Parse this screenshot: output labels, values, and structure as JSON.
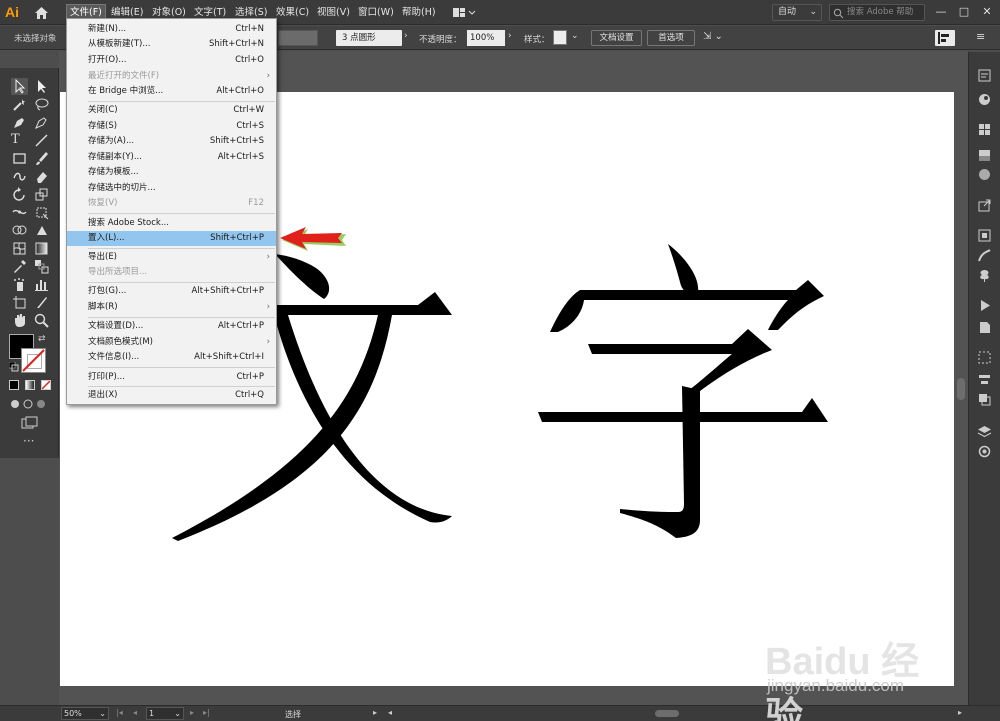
{
  "app": {
    "logo": "Ai"
  },
  "menubar": {
    "items": [
      "文件(F)",
      "编辑(E)",
      "对象(O)",
      "文字(T)",
      "选择(S)",
      "效果(C)",
      "视图(V)",
      "窗口(W)",
      "帮助(H)"
    ],
    "workspace": "自动",
    "search_placeholder": "搜索 Adobe 帮助",
    "window_buttons": [
      "—",
      "□",
      "✕"
    ]
  },
  "controlbar": {
    "no_selection": "未选择对象",
    "brush": "3 点圆形",
    "opacity_label": "不透明度：",
    "opacity_value": "100%",
    "style_label": "样式：",
    "doc_setup": "文档设置",
    "preferences": "首选项"
  },
  "file_menu": {
    "items": [
      {
        "label": "新建(N)...",
        "shortcut": "Ctrl+N"
      },
      {
        "label": "从模板新建(T)...",
        "shortcut": "Shift+Ctrl+N"
      },
      {
        "label": "打开(O)...",
        "shortcut": "Ctrl+O"
      },
      {
        "label": "最近打开的文件(F)",
        "shortcut": "›"
      },
      {
        "label": "在 Bridge 中浏览...",
        "shortcut": "Alt+Ctrl+O"
      },
      {
        "label": "关闭(C)",
        "shortcut": "Ctrl+W"
      },
      {
        "label": "存储(S)",
        "shortcut": "Ctrl+S"
      },
      {
        "label": "存储为(A)...",
        "shortcut": "Shift+Ctrl+S"
      },
      {
        "label": "存储副本(Y)...",
        "shortcut": "Alt+Ctrl+S"
      },
      {
        "label": "存储为模板...",
        "shortcut": ""
      },
      {
        "label": "存储选中的切片...",
        "shortcut": ""
      },
      {
        "label": "恢复(V)",
        "shortcut": "F12"
      },
      {
        "label": "搜索 Adobe Stock...",
        "shortcut": ""
      },
      {
        "label": "置入(L)...",
        "shortcut": "Shift+Ctrl+P"
      },
      {
        "label": "导出(E)",
        "shortcut": "›"
      },
      {
        "label": "导出所选项目...",
        "shortcut": ""
      },
      {
        "label": "打包(G)...",
        "shortcut": "Alt+Shift+Ctrl+P"
      },
      {
        "label": "脚本(R)",
        "shortcut": "›"
      },
      {
        "label": "文档设置(D)...",
        "shortcut": "Alt+Ctrl+P"
      },
      {
        "label": "文档颜色模式(M)",
        "shortcut": "›"
      },
      {
        "label": "文件信息(I)...",
        "shortcut": "Alt+Shift+Ctrl+I"
      },
      {
        "label": "打印(P)...",
        "shortcut": "Ctrl+P"
      },
      {
        "label": "退出(X)",
        "shortcut": "Ctrl+Q"
      }
    ]
  },
  "artboard": {
    "text_char1": "文",
    "text_char2": "字"
  },
  "statusbar": {
    "zoom": "50%",
    "page": "1",
    "tool": "选择"
  },
  "watermark": {
    "logo": "Baidu 经验",
    "url": "jingyan.baidu.com"
  },
  "colors": {
    "accent_highlight": "#92c6ef",
    "annotation_arrow": "#e0201a",
    "logo": "#ff9a00"
  }
}
